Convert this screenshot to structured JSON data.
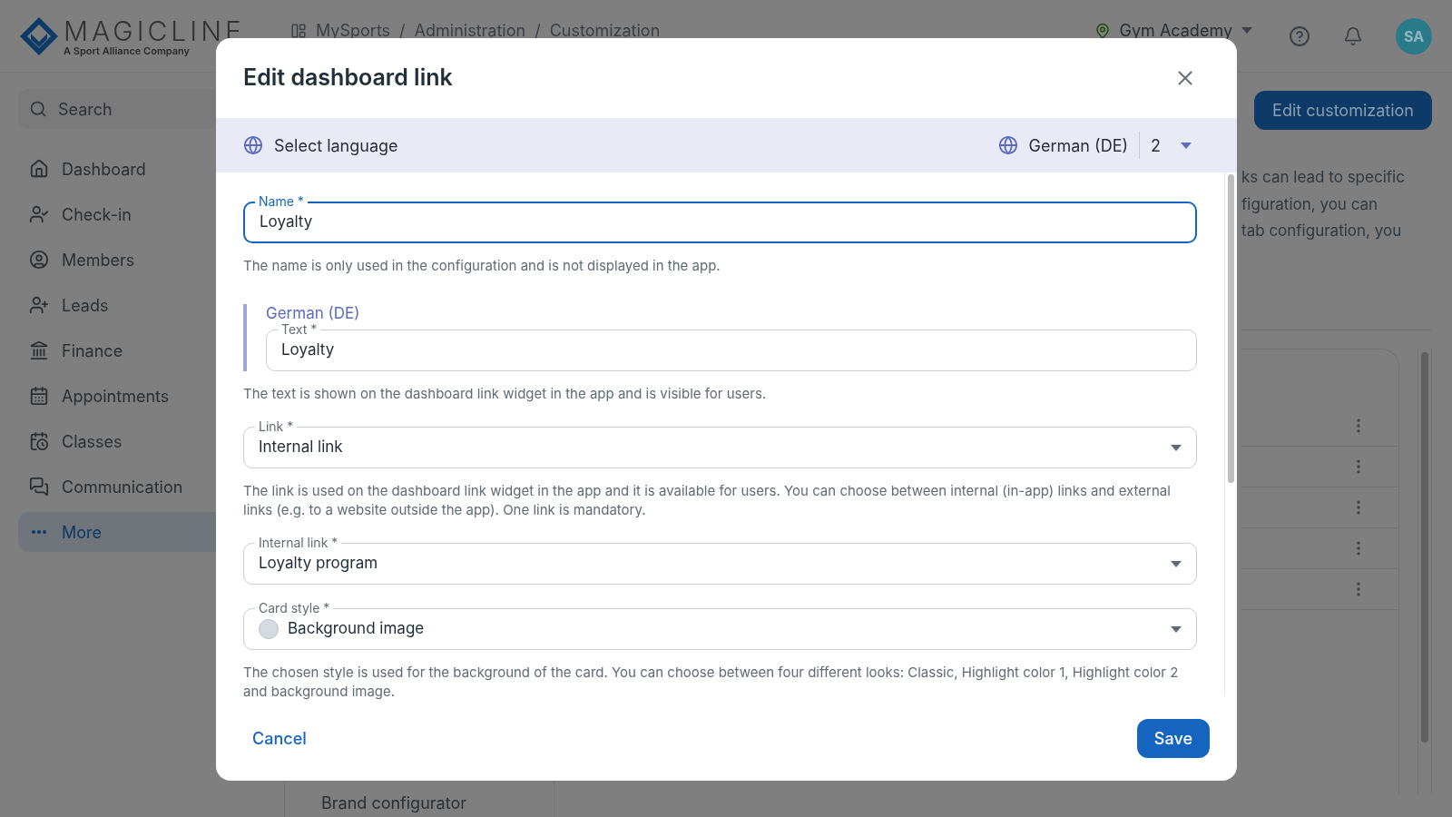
{
  "app": {
    "logo": {
      "name": "MAGICLINE",
      "tagline": "A Sport Alliance Company"
    },
    "breadcrumbs": [
      "MySports",
      "Administration",
      "Customization"
    ],
    "separator": "/",
    "location": "Gym Academy",
    "avatar": "SA",
    "search": {
      "placeholder": "Search"
    },
    "nav": [
      {
        "label": "Dashboard",
        "selected": false
      },
      {
        "label": "Check-in",
        "selected": false
      },
      {
        "label": "Members",
        "selected": false
      },
      {
        "label": "Leads",
        "selected": false
      },
      {
        "label": "Finance",
        "selected": false
      },
      {
        "label": "Appointments",
        "selected": false
      },
      {
        "label": "Classes",
        "selected": false
      },
      {
        "label": "Communication",
        "selected": false
      },
      {
        "label": "More",
        "selected": true
      }
    ],
    "edit_button": "Edit customization",
    "description_lines": [
      "ks can lead to specific",
      "figuration, you can",
      "tab configuration, you"
    ],
    "sub_nav_item": "Brand configurator"
  },
  "dialog": {
    "title": "Edit dashboard link",
    "language_bar": {
      "label": "Select language",
      "current": "German (DE)",
      "count": "2"
    },
    "fields": [
      {
        "kind": "text",
        "label": "Name *",
        "value": "Loyalty",
        "focused": true,
        "help": "The name is only used in the configuration and is not displayed in the app."
      },
      {
        "kind": "translated",
        "section": "German (DE)",
        "label": "Text *",
        "value": "Loyalty",
        "focused": false,
        "help": "The text is shown on the dashboard link widget in the app and is visible for users."
      },
      {
        "kind": "select",
        "label": "Link *",
        "value": "Internal link",
        "focused": false,
        "help": "The link is used on the dashboard link widget in the app and it is available for users. You can choose between internal (in-app) links and external links (e.g. to a website outside the app). One link is mandatory."
      },
      {
        "kind": "select",
        "label": "Internal link *",
        "value": "Loyalty program",
        "focused": false
      },
      {
        "kind": "style_select",
        "label": "Card style *",
        "value": "Background image",
        "focused": false,
        "help": "The chosen style is used for the background of the card. You can choose between four different looks: Classic, Highlight color 1, Highlight color 2 and background image."
      }
    ],
    "cancel": "Cancel",
    "save": "Save"
  }
}
